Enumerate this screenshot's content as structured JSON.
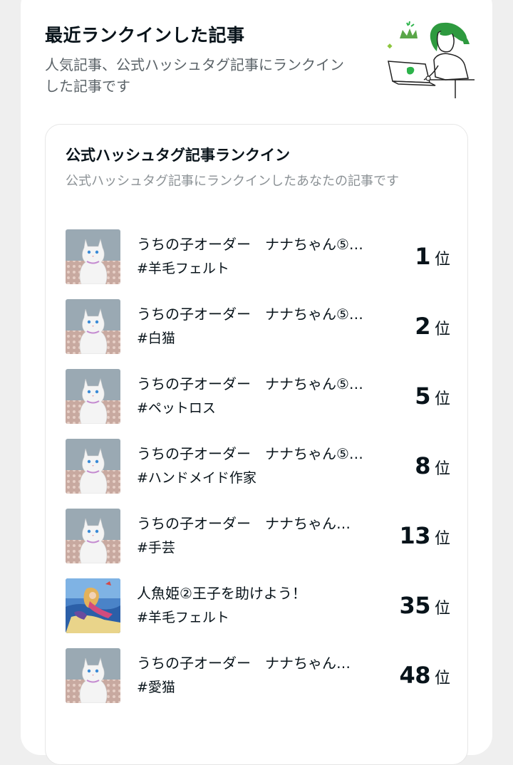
{
  "header": {
    "title": "最近ランクインした記事",
    "subtitle": "人気記事、公式ハッシュタグ記事にランクインした記事です"
  },
  "section": {
    "title": "公式ハッシュタグ記事ランクイン",
    "subtitle": "公式ハッシュタグ記事にランクインしたあなたの記事です"
  },
  "rank_unit": "位",
  "items": [
    {
      "title": "うちの子オーダー　ナナちゃん⑤…",
      "tag": "#羊毛フェルト",
      "rank": "1",
      "thumb": "cat"
    },
    {
      "title": "うちの子オーダー　ナナちゃん⑤…",
      "tag": "#白猫",
      "rank": "2",
      "thumb": "cat"
    },
    {
      "title": "うちの子オーダー　ナナちゃん⑤…",
      "tag": "#ペットロス",
      "rank": "5",
      "thumb": "cat"
    },
    {
      "title": "うちの子オーダー　ナナちゃん⑤…",
      "tag": "#ハンドメイド作家",
      "rank": "8",
      "thumb": "cat"
    },
    {
      "title": "うちの子オーダー　ナナちゃん…",
      "tag": "#手芸",
      "rank": "13",
      "thumb": "cat"
    },
    {
      "title": "人魚姫②王子を助けよう！",
      "tag": "#羊毛フェルト",
      "rank": "35",
      "thumb": "mermaid"
    },
    {
      "title": "うちの子オーダー　ナナちゃん…",
      "tag": "#愛猫",
      "rank": "48",
      "thumb": "cat"
    }
  ],
  "colors": {
    "accent_green": "#2cb34a",
    "text": "#08131a",
    "subtext": "#5b6368"
  }
}
